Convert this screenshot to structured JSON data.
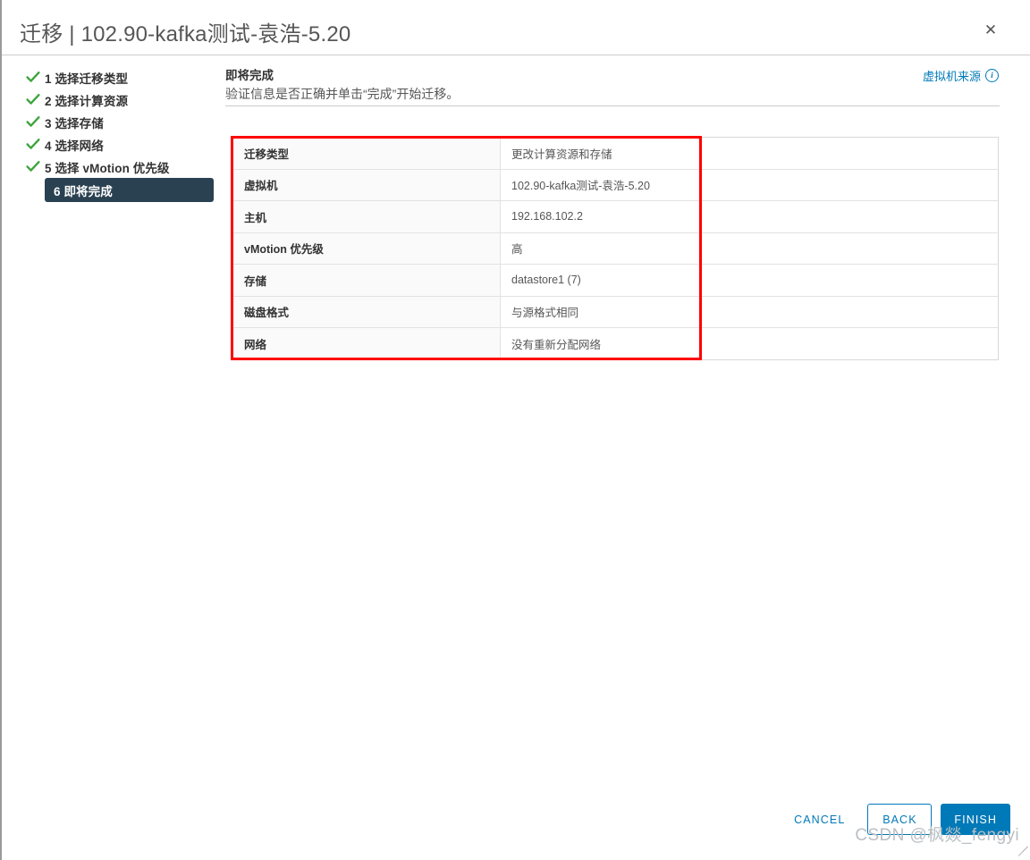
{
  "window": {
    "title": "迁移 | 102.90-kafka测试-袁浩-5.20",
    "close_icon": "close-icon",
    "close_glyph": "✕"
  },
  "steps": [
    {
      "label": "1 选择迁移类型",
      "state": "done",
      "icon": "check-icon"
    },
    {
      "label": "2 选择计算资源",
      "state": "done",
      "icon": "check-icon"
    },
    {
      "label": "3 选择存储",
      "state": "done",
      "icon": "check-icon"
    },
    {
      "label": "4 选择网络",
      "state": "done",
      "icon": "check-icon"
    },
    {
      "label": "5 选择 vMotion 优先级",
      "state": "done",
      "icon": "check-icon"
    },
    {
      "label": "6 即将完成",
      "state": "active",
      "icon": "none"
    }
  ],
  "main": {
    "heading": "即将完成",
    "subheading": "验证信息是否正确并单击“完成”开始迁移。",
    "vm_source_link": "虚拟机来源",
    "vm_source_info_icon": "info-icon",
    "vm_source_info_glyph": "i"
  },
  "summary_table": {
    "rows": [
      {
        "label": "迁移类型",
        "value": "更改计算资源和存储"
      },
      {
        "label": "虚拟机",
        "value": "102.90-kafka测试-袁浩-5.20"
      },
      {
        "label": "主机",
        "value": "192.168.102.2"
      },
      {
        "label": "vMotion 优先级",
        "value": "高"
      },
      {
        "label": "存储",
        "value": "datastore1 (7)"
      },
      {
        "label": "磁盘格式",
        "value": "与源格式相同"
      },
      {
        "label": "网络",
        "value": "没有重新分配网络"
      }
    ]
  },
  "annotation": {
    "highlight_color": "#fe0000"
  },
  "footer": {
    "cancel_label": "CANCEL",
    "back_label": "BACK",
    "finish_label": "FINISH"
  },
  "watermark": {
    "text": "CSDN @枫燚_fengyi"
  },
  "colors": {
    "accent_blue": "#0079b8",
    "active_step_bg": "#2a4151",
    "check_green": "#3ea53e",
    "annotation_red": "#fe0000"
  }
}
